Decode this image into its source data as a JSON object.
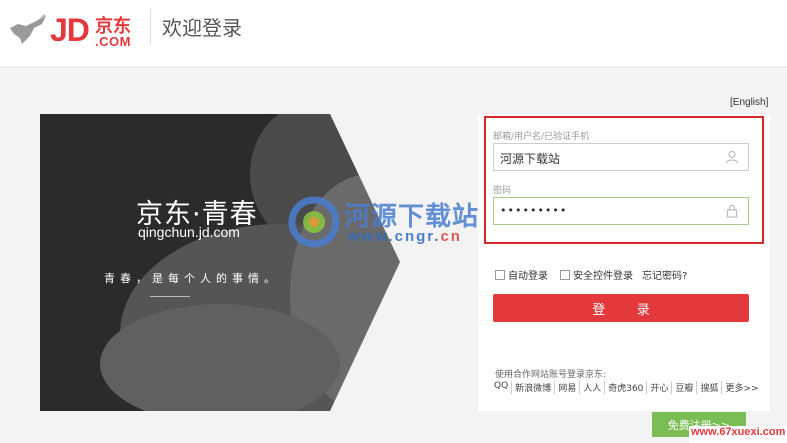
{
  "header": {
    "logo_jd": "JD",
    "logo_cn": "京东",
    "logo_com": ".COM",
    "welcome": "欢迎登录"
  },
  "lang_link": "[English]",
  "banner": {
    "title": "京东·青春",
    "url": "qingchun.jd.com",
    "slogan": "青春，是每个人的事情。"
  },
  "login": {
    "username_label": "邮箱/用户名/已验证手机",
    "username_value": "河源下载站",
    "password_label": "密码",
    "password_value": "•••••••••",
    "auto_login": "自动登录",
    "secure_control": "安全控件登录",
    "forgot": "忘记密码?",
    "submit": "登 录"
  },
  "partners": {
    "title": "使用合作网站账号登录京东:",
    "items": [
      "QQ",
      "新浪微博",
      "网易",
      "人人",
      "奇虎360",
      "开心",
      "豆瓣",
      "搜狐",
      "更多>>"
    ]
  },
  "register": "免费注册>>",
  "watermark": {
    "text": "河源下载站",
    "url_main": "www.cngr.",
    "url_cn": "cn",
    "corner": "www.67xuexi.com"
  },
  "colors": {
    "brand": "#e4393c",
    "highlight": "#d9252b",
    "register": "#7abd54"
  }
}
